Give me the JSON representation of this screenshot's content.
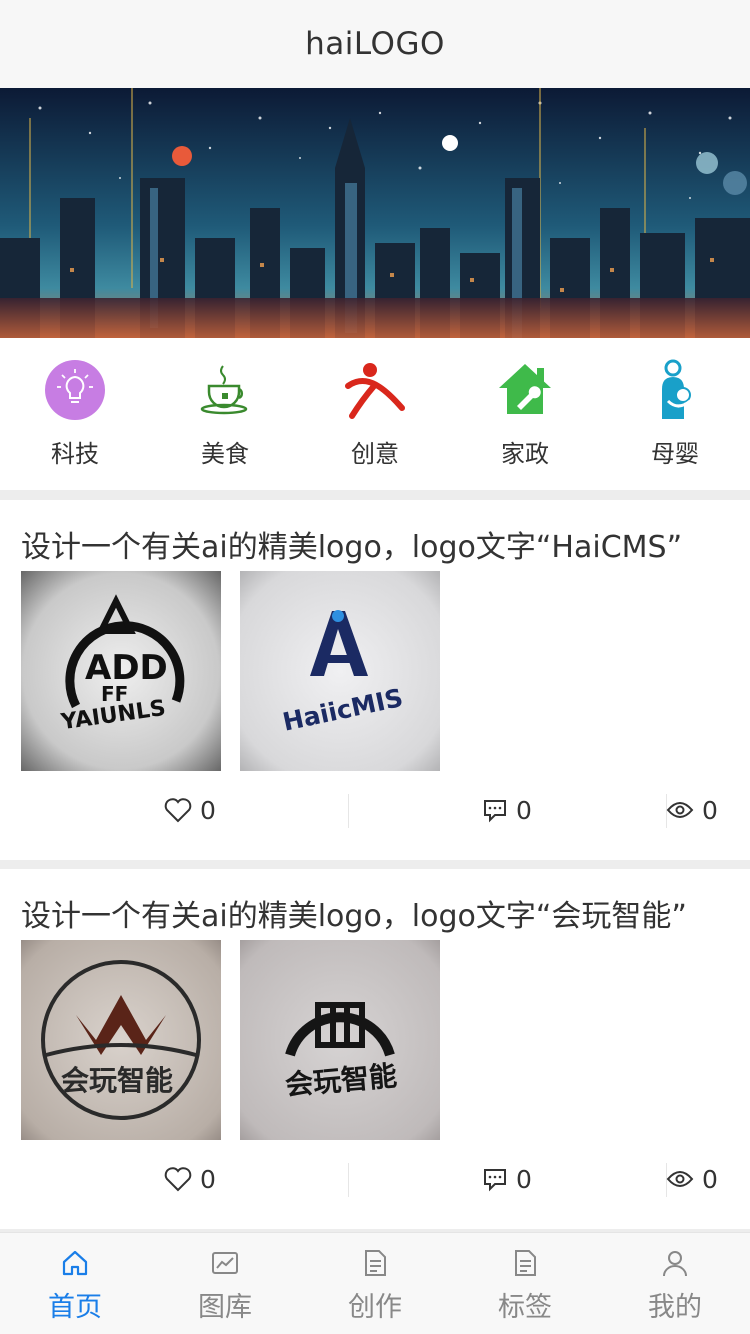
{
  "header": {
    "title": "haiLOGO"
  },
  "categories": [
    {
      "label": "科技",
      "icon": "lightbulb-icon",
      "color": "#c77de3"
    },
    {
      "label": "美食",
      "icon": "teacup-icon",
      "color": "#3a8a2e"
    },
    {
      "label": "创意",
      "icon": "person-icon",
      "color": "#d9271c"
    },
    {
      "label": "家政",
      "icon": "house-wrench-icon",
      "color": "#3fba4a"
    },
    {
      "label": "母婴",
      "icon": "mother-baby-icon",
      "color": "#19a0c9"
    }
  ],
  "posts": [
    {
      "title": "设计一个有关ai的精美logo，logo文字“HaiCMS”",
      "likes": "0",
      "comments": "0",
      "views": "0",
      "images": [
        "ADD FF logo",
        "HaiicMIS logo"
      ]
    },
    {
      "title": "设计一个有关ai的精美logo，logo文字“会玩智能”",
      "likes": "0",
      "comments": "0",
      "views": "0",
      "images": [
        "YAV 会玩智能 logo",
        "II 会玩智能 logo"
      ]
    }
  ],
  "tabbar": [
    {
      "label": "首页",
      "icon": "home-icon",
      "active": true
    },
    {
      "label": "图库",
      "icon": "gallery-icon",
      "active": false
    },
    {
      "label": "创作",
      "icon": "document-icon",
      "active": false
    },
    {
      "label": "标签",
      "icon": "tag-document-icon",
      "active": false
    },
    {
      "label": "我的",
      "icon": "user-icon",
      "active": false
    }
  ],
  "colors": {
    "accent": "#1a7ee8",
    "tab_inactive": "#888888"
  }
}
